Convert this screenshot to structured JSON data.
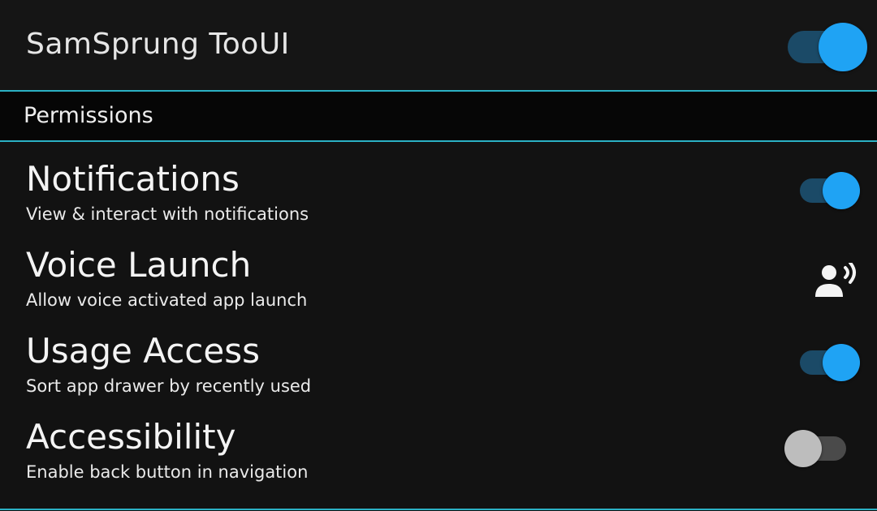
{
  "header": {
    "app_title": "SamSprung TooUI",
    "master_toggle": "on"
  },
  "section": {
    "title": "Permissions"
  },
  "rows": [
    {
      "title": "Notifications",
      "subtitle": "View & interact with notifications",
      "control": "toggle",
      "state": "on"
    },
    {
      "title": "Voice Launch",
      "subtitle": "Allow voice activated app launch",
      "control": "icon",
      "icon": "record-voice-icon"
    },
    {
      "title": "Usage Access",
      "subtitle": "Sort app drawer by recently used",
      "control": "toggle",
      "state": "on"
    },
    {
      "title": "Accessibility",
      "subtitle": "Enable back button in navigation",
      "control": "toggle",
      "state": "off"
    }
  ],
  "colors": {
    "background": "#121212",
    "accent": "#1fa3f4",
    "divider": "#2bb1c4"
  }
}
